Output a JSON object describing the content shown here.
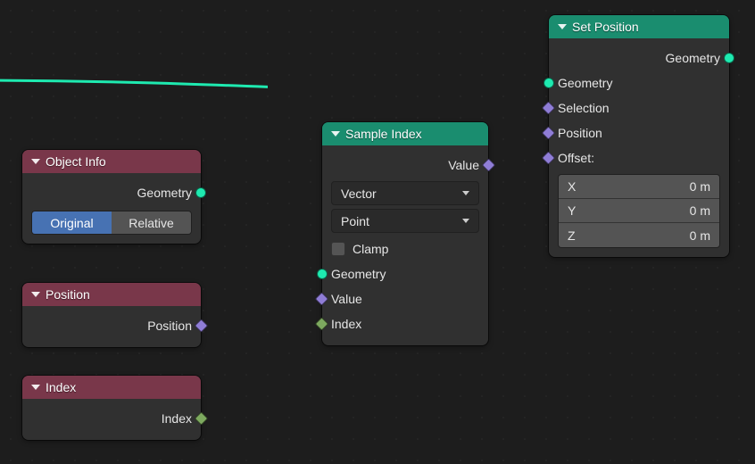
{
  "nodes": {
    "objectInfo": {
      "title": "Object Info",
      "geometry_label": "Geometry",
      "toggle": {
        "original": "Original",
        "relative": "Relative"
      }
    },
    "position": {
      "title": "Position",
      "output_label": "Position"
    },
    "index": {
      "title": "Index",
      "output_label": "Index"
    },
    "sampleIndex": {
      "title": "Sample Index",
      "value_out": "Value",
      "type_select": "Vector",
      "domain_select": "Point",
      "clamp_label": "Clamp",
      "geometry_in": "Geometry",
      "value_in": "Value",
      "index_in": "Index"
    },
    "setPosition": {
      "title": "Set Position",
      "geometry_out": "Geometry",
      "geometry_in": "Geometry",
      "selection_in": "Selection",
      "position_in": "Position",
      "offset_label": "Offset:",
      "offset": {
        "xl": "X",
        "xv": "0 m",
        "yl": "Y",
        "yv": "0 m",
        "zl": "Z",
        "zv": "0 m"
      }
    }
  }
}
